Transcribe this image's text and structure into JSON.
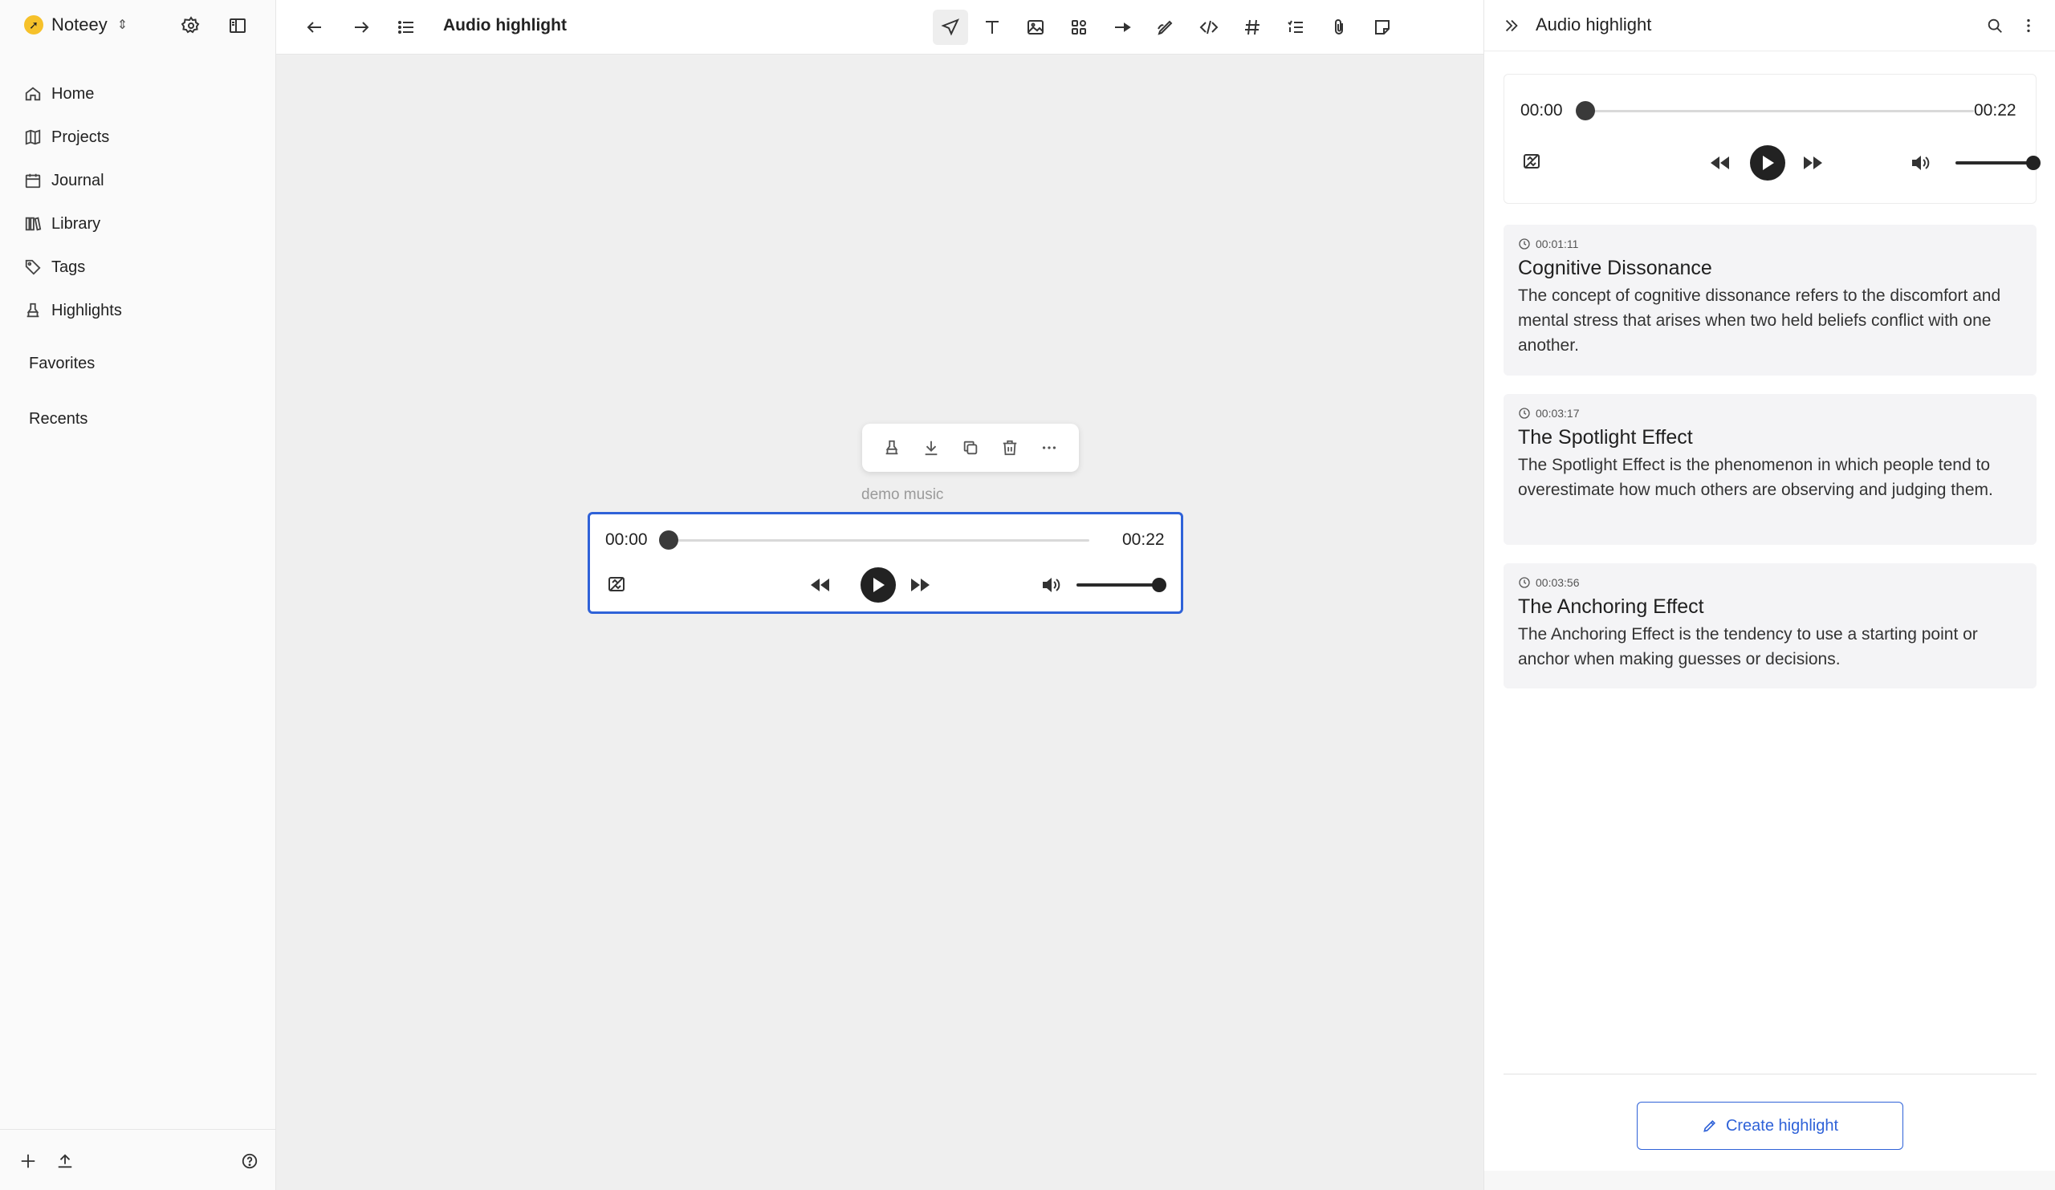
{
  "app": {
    "name": "Noteey"
  },
  "sidebar": {
    "items": [
      {
        "label": "Home",
        "icon": "home-icon"
      },
      {
        "label": "Projects",
        "icon": "map-icon"
      },
      {
        "label": "Journal",
        "icon": "calendar-icon"
      },
      {
        "label": "Library",
        "icon": "library-icon"
      },
      {
        "label": "Tags",
        "icon": "tag-icon"
      },
      {
        "label": "Highlights",
        "icon": "highlighter-icon"
      }
    ],
    "favorites": "Favorites",
    "recents": "Recents"
  },
  "topbar": {
    "title": "Audio highlight"
  },
  "block": {
    "caption": "demo music",
    "player": {
      "current": "00:00",
      "duration": "00:22",
      "progress": 0,
      "volume": 1.0
    }
  },
  "panel": {
    "title": "Audio highlight",
    "player": {
      "current": "00:00",
      "duration": "00:22",
      "progress": 0,
      "volume": 1.0
    },
    "highlights": [
      {
        "time": "00:01:11",
        "title": "Cognitive Dissonance",
        "body": "The concept of cognitive dissonance refers to the discomfort and mental stress that arises when two held beliefs conflict with one another."
      },
      {
        "time": "00:03:17",
        "title": "The Spotlight Effect",
        "body": "The Spotlight Effect is the phenomenon in which people tend to overestimate how much others are observing and judging them."
      },
      {
        "time": "00:03:56",
        "title": "The Anchoring Effect",
        "body": "The Anchoring Effect is the tendency to use a starting point or anchor when making guesses or decisions."
      }
    ],
    "create_label": "Create highlight"
  },
  "colors": {
    "accent": "#2f62d8",
    "brand": "#f6c12a"
  }
}
